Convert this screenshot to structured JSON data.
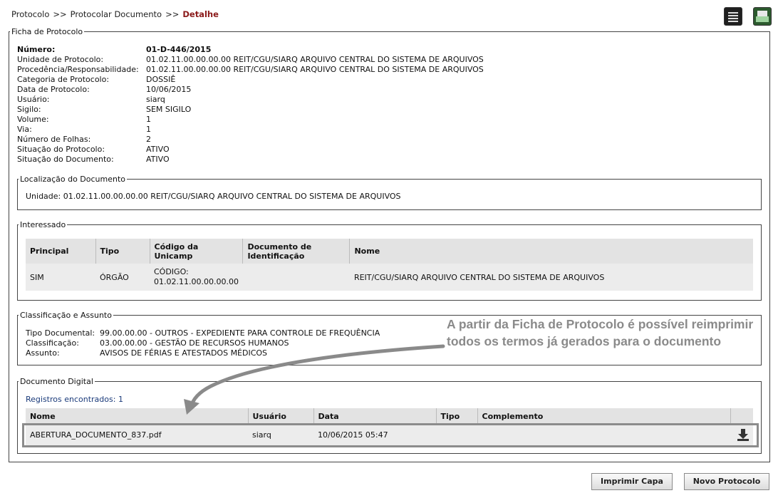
{
  "breadcrumb": {
    "items": [
      "Protocolo",
      "Protocolar Documento"
    ],
    "separator": ">>",
    "current": "Detalhe"
  },
  "toolbar": {
    "icons": [
      "list-icon",
      "print-icon"
    ]
  },
  "ficha": {
    "legend": "Ficha de Protocolo",
    "fields": [
      {
        "label": "Número:",
        "value": "01-D-446/2015"
      },
      {
        "label": "Unidade de Protocolo:",
        "value": "01.02.11.00.00.00.00 REIT/CGU/SIARQ ARQUIVO CENTRAL DO SISTEMA DE ARQUIVOS"
      },
      {
        "label": "Procedência/Responsabilidade:",
        "value": "01.02.11.00.00.00.00 REIT/CGU/SIARQ ARQUIVO CENTRAL DO SISTEMA DE ARQUIVOS"
      },
      {
        "label": "Categoria de Protocolo:",
        "value": "DOSSIÊ"
      },
      {
        "label": "Data de Protocolo:",
        "value": "10/06/2015"
      },
      {
        "label": "Usuário:",
        "value": "siarq"
      },
      {
        "label": "Sigilo:",
        "value": "SEM SIGILO"
      },
      {
        "label": "Volume:",
        "value": "1"
      },
      {
        "label": "Via:",
        "value": "1"
      },
      {
        "label": "Número de Folhas:",
        "value": "2"
      },
      {
        "label": "Situação do Protocolo:",
        "value": "ATIVO"
      },
      {
        "label": "Situação do Documento:",
        "value": "ATIVO"
      }
    ]
  },
  "localizacao": {
    "legend": "Localização do Documento",
    "text": "Unidade: 01.02.11.00.00.00.00 REIT/CGU/SIARQ ARQUIVO CENTRAL DO SISTEMA DE ARQUIVOS"
  },
  "interessado": {
    "legend": "Interessado",
    "headers": [
      "Principal",
      "Tipo",
      "Código da Unicamp",
      "Documento de Identificação",
      "Nome"
    ],
    "rows": [
      [
        "SIM",
        "ÓRGÃO",
        "CÓDIGO: 01.02.11.00.00.00.00",
        "",
        "REIT/CGU/SIARQ ARQUIVO CENTRAL DO SISTEMA DE ARQUIVOS"
      ]
    ]
  },
  "classificacao": {
    "legend": "Classificação e Assunto",
    "fields": [
      {
        "label": "Tipo Documental:",
        "value": "99.00.00.00 - OUTROS  - EXPEDIENTE PARA CONTROLE DE FREQUÊNCIA"
      },
      {
        "label": "Classificação:",
        "value": "03.00.00.00 - GESTÃO DE RECURSOS HUMANOS"
      },
      {
        "label": "Assunto:",
        "value": "AVISOS DE FÉRIAS E ATESTADOS MÉDICOS"
      }
    ]
  },
  "annotation": "A partir da Ficha de Protocolo é possível reimprimir todos os termos já gerados para o documento",
  "digital": {
    "legend": "Documento Digital",
    "records": "Registros encontrados: 1",
    "headers": [
      "Nome",
      "Usuário",
      "Data",
      "Tipo",
      "Complemento"
    ],
    "rows": [
      {
        "nome": "ABERTURA_DOCUMENTO_837.pdf",
        "usuario": "siarq",
        "data": "10/06/2015 05:47",
        "tipo": "",
        "complemento": "",
        "action_icon": "download-icon"
      }
    ]
  },
  "buttons": {
    "imprimir_capa": "Imprimir Capa",
    "novo_protocolo": "Novo Protocolo"
  },
  "colors": {
    "breadcrumb_current": "#8b1a1a",
    "annotation": "#8a8a8a",
    "link": "#1a3a7a"
  }
}
